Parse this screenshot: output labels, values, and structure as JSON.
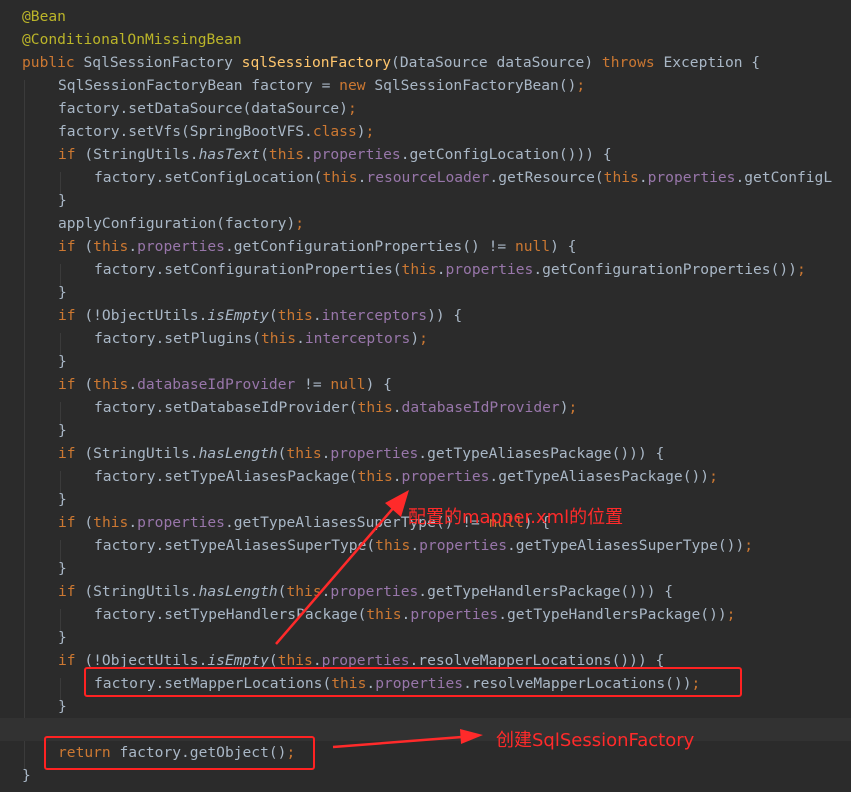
{
  "colors": {
    "background": "#2b2b2b",
    "current_line": "#323232",
    "keyword": "#cc7832",
    "annotation": "#bbb529",
    "field": "#9876aa",
    "method_decl": "#ffc66d",
    "plain": "#a9b7c6",
    "highlight": "#ff2222"
  },
  "code_lines": [
    {
      "indent": 0,
      "tokens": [
        {
          "t": "@Bean",
          "c": "ann"
        }
      ]
    },
    {
      "indent": 0,
      "tokens": [
        {
          "t": "@ConditionalOnMissingBean",
          "c": "ann"
        }
      ]
    },
    {
      "indent": 0,
      "tokens": [
        {
          "t": "public ",
          "c": "kw"
        },
        {
          "t": "SqlSessionFactory ",
          "c": "p"
        },
        {
          "t": "sqlSessionFactory",
          "c": "fn"
        },
        {
          "t": "(DataSource dataSource) ",
          "c": "p"
        },
        {
          "t": "throws ",
          "c": "kw"
        },
        {
          "t": "Exception {",
          "c": "p"
        }
      ]
    },
    {
      "indent": 1,
      "tokens": [
        {
          "t": "SqlSessionFactoryBean factory = ",
          "c": "p"
        },
        {
          "t": "new ",
          "c": "kw"
        },
        {
          "t": "SqlSessionFactoryBean()",
          "c": "p"
        },
        {
          "t": ";",
          "c": "kw"
        }
      ]
    },
    {
      "indent": 1,
      "tokens": [
        {
          "t": "factory.setDataSource(dataSource)",
          "c": "p"
        },
        {
          "t": ";",
          "c": "kw"
        }
      ]
    },
    {
      "indent": 1,
      "tokens": [
        {
          "t": "factory.setVfs(SpringBootVFS.",
          "c": "p"
        },
        {
          "t": "class",
          "c": "kw"
        },
        {
          "t": ")",
          "c": "p"
        },
        {
          "t": ";",
          "c": "kw"
        }
      ]
    },
    {
      "indent": 1,
      "tokens": [
        {
          "t": "if ",
          "c": "kw"
        },
        {
          "t": "(StringUtils.",
          "c": "p"
        },
        {
          "t": "hasText",
          "c": "it"
        },
        {
          "t": "(",
          "c": "p"
        },
        {
          "t": "this",
          "c": "kw"
        },
        {
          "t": ".",
          "c": "p"
        },
        {
          "t": "properties",
          "c": "f"
        },
        {
          "t": ".getConfigLocation())) {",
          "c": "p"
        }
      ]
    },
    {
      "indent": 2,
      "tokens": [
        {
          "t": "factory.setConfigLocation(",
          "c": "p"
        },
        {
          "t": "this",
          "c": "kw"
        },
        {
          "t": ".",
          "c": "p"
        },
        {
          "t": "resourceLoader",
          "c": "f"
        },
        {
          "t": ".getResource(",
          "c": "p"
        },
        {
          "t": "this",
          "c": "kw"
        },
        {
          "t": ".",
          "c": "p"
        },
        {
          "t": "properties",
          "c": "f"
        },
        {
          "t": ".getConfigL",
          "c": "p"
        }
      ]
    },
    {
      "indent": 1,
      "tokens": [
        {
          "t": "}",
          "c": "p"
        }
      ]
    },
    {
      "indent": 1,
      "tokens": [
        {
          "t": "applyConfiguration(factory)",
          "c": "p"
        },
        {
          "t": ";",
          "c": "kw"
        }
      ]
    },
    {
      "indent": 1,
      "tokens": [
        {
          "t": "if ",
          "c": "kw"
        },
        {
          "t": "(",
          "c": "p"
        },
        {
          "t": "this",
          "c": "kw"
        },
        {
          "t": ".",
          "c": "p"
        },
        {
          "t": "properties",
          "c": "f"
        },
        {
          "t": ".getConfigurationProperties() != ",
          "c": "p"
        },
        {
          "t": "null",
          "c": "kw"
        },
        {
          "t": ") {",
          "c": "p"
        }
      ]
    },
    {
      "indent": 2,
      "tokens": [
        {
          "t": "factory.setConfigurationProperties(",
          "c": "p"
        },
        {
          "t": "this",
          "c": "kw"
        },
        {
          "t": ".",
          "c": "p"
        },
        {
          "t": "properties",
          "c": "f"
        },
        {
          "t": ".getConfigurationProperties())",
          "c": "p"
        },
        {
          "t": ";",
          "c": "kw"
        }
      ]
    },
    {
      "indent": 1,
      "tokens": [
        {
          "t": "}",
          "c": "p"
        }
      ]
    },
    {
      "indent": 1,
      "tokens": [
        {
          "t": "if ",
          "c": "kw"
        },
        {
          "t": "(!ObjectUtils.",
          "c": "p"
        },
        {
          "t": "isEmpty",
          "c": "it"
        },
        {
          "t": "(",
          "c": "p"
        },
        {
          "t": "this",
          "c": "kw"
        },
        {
          "t": ".",
          "c": "p"
        },
        {
          "t": "interceptors",
          "c": "f"
        },
        {
          "t": ")) {",
          "c": "p"
        }
      ]
    },
    {
      "indent": 2,
      "tokens": [
        {
          "t": "factory.setPlugins(",
          "c": "p"
        },
        {
          "t": "this",
          "c": "kw"
        },
        {
          "t": ".",
          "c": "p"
        },
        {
          "t": "interceptors",
          "c": "f"
        },
        {
          "t": ")",
          "c": "p"
        },
        {
          "t": ";",
          "c": "kw"
        }
      ]
    },
    {
      "indent": 1,
      "tokens": [
        {
          "t": "}",
          "c": "p"
        }
      ]
    },
    {
      "indent": 1,
      "tokens": [
        {
          "t": "if ",
          "c": "kw"
        },
        {
          "t": "(",
          "c": "p"
        },
        {
          "t": "this",
          "c": "kw"
        },
        {
          "t": ".",
          "c": "p"
        },
        {
          "t": "databaseIdProvider",
          "c": "f"
        },
        {
          "t": " != ",
          "c": "p"
        },
        {
          "t": "null",
          "c": "kw"
        },
        {
          "t": ") {",
          "c": "p"
        }
      ]
    },
    {
      "indent": 2,
      "tokens": [
        {
          "t": "factory.setDatabaseIdProvider(",
          "c": "p"
        },
        {
          "t": "this",
          "c": "kw"
        },
        {
          "t": ".",
          "c": "p"
        },
        {
          "t": "databaseIdProvider",
          "c": "f"
        },
        {
          "t": ")",
          "c": "p"
        },
        {
          "t": ";",
          "c": "kw"
        }
      ]
    },
    {
      "indent": 1,
      "tokens": [
        {
          "t": "}",
          "c": "p"
        }
      ]
    },
    {
      "indent": 1,
      "tokens": [
        {
          "t": "if ",
          "c": "kw"
        },
        {
          "t": "(StringUtils.",
          "c": "p"
        },
        {
          "t": "hasLength",
          "c": "it"
        },
        {
          "t": "(",
          "c": "p"
        },
        {
          "t": "this",
          "c": "kw"
        },
        {
          "t": ".",
          "c": "p"
        },
        {
          "t": "properties",
          "c": "f"
        },
        {
          "t": ".getTypeAliasesPackage())) {",
          "c": "p"
        }
      ]
    },
    {
      "indent": 2,
      "tokens": [
        {
          "t": "factory.setTypeAliasesPackage(",
          "c": "p"
        },
        {
          "t": "this",
          "c": "kw"
        },
        {
          "t": ".",
          "c": "p"
        },
        {
          "t": "properties",
          "c": "f"
        },
        {
          "t": ".getTypeAliasesPackage())",
          "c": "p"
        },
        {
          "t": ";",
          "c": "kw"
        }
      ]
    },
    {
      "indent": 1,
      "tokens": [
        {
          "t": "}",
          "c": "p"
        }
      ]
    },
    {
      "indent": 1,
      "tokens": [
        {
          "t": "if ",
          "c": "kw"
        },
        {
          "t": "(",
          "c": "p"
        },
        {
          "t": "this",
          "c": "kw"
        },
        {
          "t": ".",
          "c": "p"
        },
        {
          "t": "properties",
          "c": "f"
        },
        {
          "t": ".getTypeAliasesSuperType() != ",
          "c": "p"
        },
        {
          "t": "null",
          "c": "kw"
        },
        {
          "t": ") {",
          "c": "p"
        }
      ]
    },
    {
      "indent": 2,
      "tokens": [
        {
          "t": "factory.setTypeAliasesSuperType(",
          "c": "p"
        },
        {
          "t": "this",
          "c": "kw"
        },
        {
          "t": ".",
          "c": "p"
        },
        {
          "t": "properties",
          "c": "f"
        },
        {
          "t": ".getTypeAliasesSuperType())",
          "c": "p"
        },
        {
          "t": ";",
          "c": "kw"
        }
      ]
    },
    {
      "indent": 1,
      "tokens": [
        {
          "t": "}",
          "c": "p"
        }
      ]
    },
    {
      "indent": 1,
      "tokens": [
        {
          "t": "if ",
          "c": "kw"
        },
        {
          "t": "(StringUtils.",
          "c": "p"
        },
        {
          "t": "hasLength",
          "c": "it"
        },
        {
          "t": "(",
          "c": "p"
        },
        {
          "t": "this",
          "c": "kw"
        },
        {
          "t": ".",
          "c": "p"
        },
        {
          "t": "properties",
          "c": "f"
        },
        {
          "t": ".getTypeHandlersPackage())) {",
          "c": "p"
        }
      ]
    },
    {
      "indent": 2,
      "tokens": [
        {
          "t": "factory.setTypeHandlersPackage(",
          "c": "p"
        },
        {
          "t": "this",
          "c": "kw"
        },
        {
          "t": ".",
          "c": "p"
        },
        {
          "t": "properties",
          "c": "f"
        },
        {
          "t": ".getTypeHandlersPackage())",
          "c": "p"
        },
        {
          "t": ";",
          "c": "kw"
        }
      ]
    },
    {
      "indent": 1,
      "tokens": [
        {
          "t": "}",
          "c": "p"
        }
      ]
    },
    {
      "indent": 1,
      "tokens": [
        {
          "t": "if ",
          "c": "kw"
        },
        {
          "t": "(!ObjectUtils.",
          "c": "p"
        },
        {
          "t": "isEmpty",
          "c": "it"
        },
        {
          "t": "(",
          "c": "p"
        },
        {
          "t": "this",
          "c": "kw"
        },
        {
          "t": ".",
          "c": "p"
        },
        {
          "t": "properties",
          "c": "f"
        },
        {
          "t": ".resolveMapperLocations())) {",
          "c": "p"
        }
      ]
    },
    {
      "indent": 2,
      "tokens": [
        {
          "t": "factory.setMapperLocations(",
          "c": "p"
        },
        {
          "t": "this",
          "c": "kw"
        },
        {
          "t": ".",
          "c": "p"
        },
        {
          "t": "properties",
          "c": "f"
        },
        {
          "t": ".resolveMapperLocations())",
          "c": "p"
        },
        {
          "t": ";",
          "c": "kw"
        }
      ]
    },
    {
      "indent": 1,
      "tokens": [
        {
          "t": "}",
          "c": "p"
        }
      ]
    },
    {
      "indent": 0,
      "tokens": [],
      "current": true
    },
    {
      "indent": 1,
      "tokens": [
        {
          "t": "return ",
          "c": "kw"
        },
        {
          "t": "factory.getObject()",
          "c": "p"
        },
        {
          "t": ";",
          "c": "kw"
        }
      ]
    },
    {
      "indent": 0,
      "tokens": [
        {
          "t": "}",
          "c": "p"
        }
      ]
    }
  ],
  "annotations": {
    "mapper_note": "配置的mapper.xml的位置",
    "factory_note": "创建SqlSessionFactory"
  }
}
